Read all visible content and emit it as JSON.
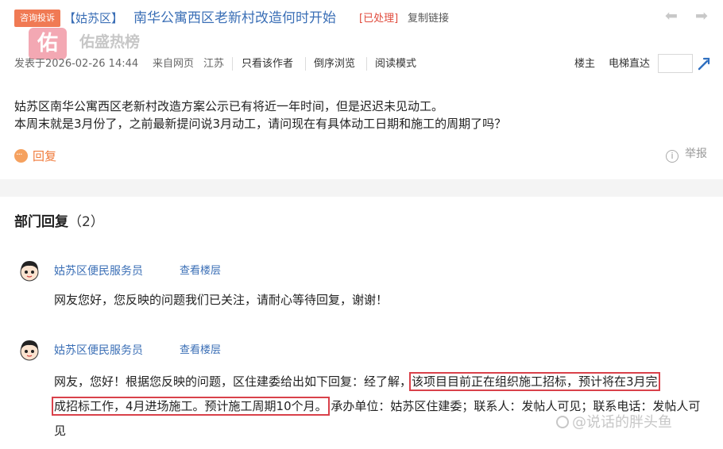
{
  "header": {
    "tag": "咨询投诉",
    "region": "【姑苏区】",
    "title": "南华公寓西区老新村改造何时开始",
    "status": "[已处理]",
    "copy_link": "复制链接"
  },
  "watermark": {
    "logo_char": "佑",
    "brand": "佑盛热榜",
    "bottom": "@说话的胖头鱼"
  },
  "meta": {
    "posted": "发表于2026-02-26 14:44",
    "source": "来自网页",
    "location": "江苏",
    "only_author": "只看该作者",
    "reverse": "倒序浏览",
    "read_mode": "阅读模式",
    "floor_owner": "楼主",
    "jump": "电梯直达",
    "jump_placeholder": ""
  },
  "post": {
    "line1": "姑苏区南华公寓西区老新村改造方案公示已有将近一年时间，但是迟迟未见动工。",
    "line2": "本周末就是3月份了，之前最新提问说3月动工，请问现在有具体动工日期和施工的周期了吗？",
    "reply_label": "回复",
    "report_label": "举报"
  },
  "replies_section": {
    "title": "部门回复",
    "count": "（2）"
  },
  "replies": [
    {
      "author": "姑苏区便民服务员",
      "view_floor": "查看楼层",
      "text": "网友您好，您反映的问题我们已关注，请耐心等待回复，谢谢！"
    },
    {
      "author": "姑苏区便民服务员",
      "view_floor": "查看楼层",
      "text_before": "网友，您好！根据您反映的问题，区住建委给出如下回复：经了解，",
      "highlight_1": "该项目目前正在组织施工招标，预计将在3月完",
      "highlight_2": "成招标工作，4月进场施工。预计施工周期10个月。",
      "text_after": "承办单位：姑苏区住建委；联系人：发帖人可见；联系电话：发帖人可见"
    }
  ],
  "colors": {
    "link_blue": "#3b6fb6",
    "tag_orange": "#f07a54",
    "status_red": "#e04b3d",
    "highlight_border": "#d9414a"
  }
}
